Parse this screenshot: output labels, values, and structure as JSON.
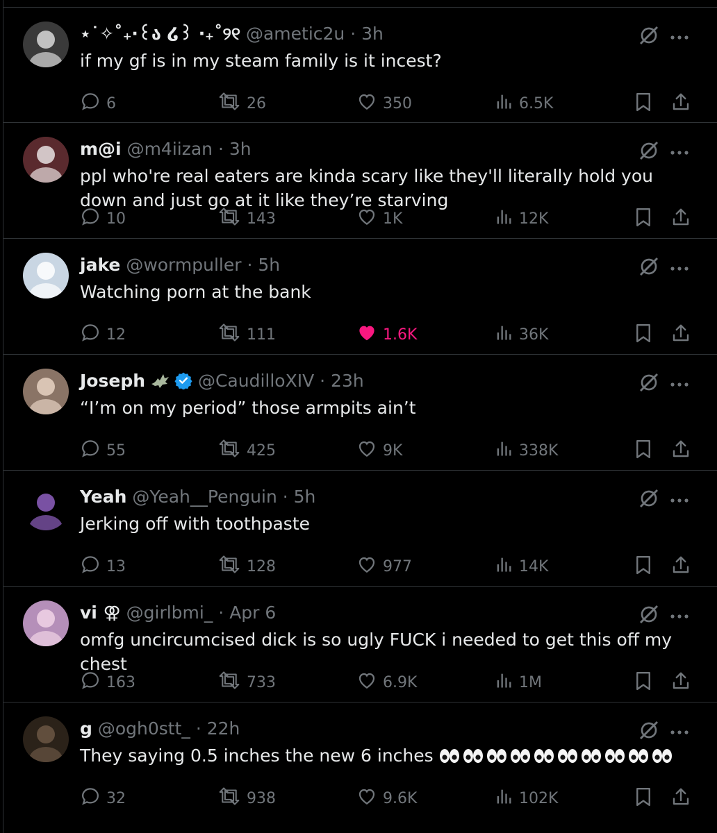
{
  "posts": [
    {
      "name": "⋆˙✧˚₊‧꒰ა ໒꒱ ‧₊˚୨୧",
      "handle": "@ametic2u",
      "time": "3h",
      "text": "if my gf is in my steam family is it incest?",
      "stats": {
        "replies": "6",
        "reposts": "26",
        "likes": "350",
        "views": "6.5K"
      },
      "liked": false,
      "avatar": {
        "bg": "#3a3a3a",
        "fg": "#d9d9d9"
      }
    },
    {
      "name": "m@i",
      "handle": "@m4iizan",
      "time": "3h",
      "text": "ppl who're real eaters are kinda scary like they'll literally hold you down and just go at it like they’re starving",
      "stats": {
        "replies": "10",
        "reposts": "143",
        "likes": "1K",
        "views": "12K"
      },
      "liked": false,
      "avatar": {
        "bg": "#5a2a2e",
        "fg": "#e8e0e0"
      }
    },
    {
      "name": "jake",
      "handle": "@wormpuller",
      "time": "5h",
      "text": "Watching porn at the bank",
      "stats": {
        "replies": "12",
        "reposts": "111",
        "likes": "1.6K",
        "views": "36K"
      },
      "liked": true,
      "avatar": {
        "bg": "#c9d6e3",
        "fg": "#ffffff"
      }
    },
    {
      "name": "Joseph",
      "handle": "@CaudilloXIV",
      "time": "23h",
      "text": "“I’m on my period” those armpits ain’t",
      "stats": {
        "replies": "55",
        "reposts": "425",
        "likes": "9K",
        "views": "338K"
      },
      "liked": false,
      "verified": true,
      "avatar": {
        "bg": "#8a7466",
        "fg": "#e6d2c2"
      }
    },
    {
      "name": "Yeah",
      "handle": "@Yeah__Penguin",
      "time": "5h",
      "text": "Jerking off with toothpaste",
      "stats": {
        "replies": "13",
        "reposts": "128",
        "likes": "977",
        "views": "14K"
      },
      "liked": false,
      "avatar": {
        "bg": "#000000",
        "fg": "#8e5fbf"
      }
    },
    {
      "name": "vi ⚢",
      "handle": "@girlbmi_",
      "time": "Apr 6",
      "text": "omfg uncircumcised dick is so ugly FUCK i needed to get this off my chest",
      "stats": {
        "replies": "163",
        "reposts": "733",
        "likes": "6.9K",
        "views": "1M"
      },
      "liked": false,
      "avatar": {
        "bg": "#b58fb9",
        "fg": "#f1d3e6"
      }
    },
    {
      "name": "g",
      "handle": "@ogh0stt_",
      "time": "22h",
      "text": "They saying 0.5 inches the new 6 inches",
      "eyes_count": 10,
      "stats": {
        "replies": "32",
        "reposts": "938",
        "likes": "9.6K",
        "views": "102K"
      },
      "liked": false,
      "avatar": {
        "bg": "#2b2219",
        "fg": "#6b5644"
      }
    }
  ],
  "colors": {
    "accent_like": "#f91880",
    "muted": "#71767b",
    "verified": "#1d9bf0"
  }
}
